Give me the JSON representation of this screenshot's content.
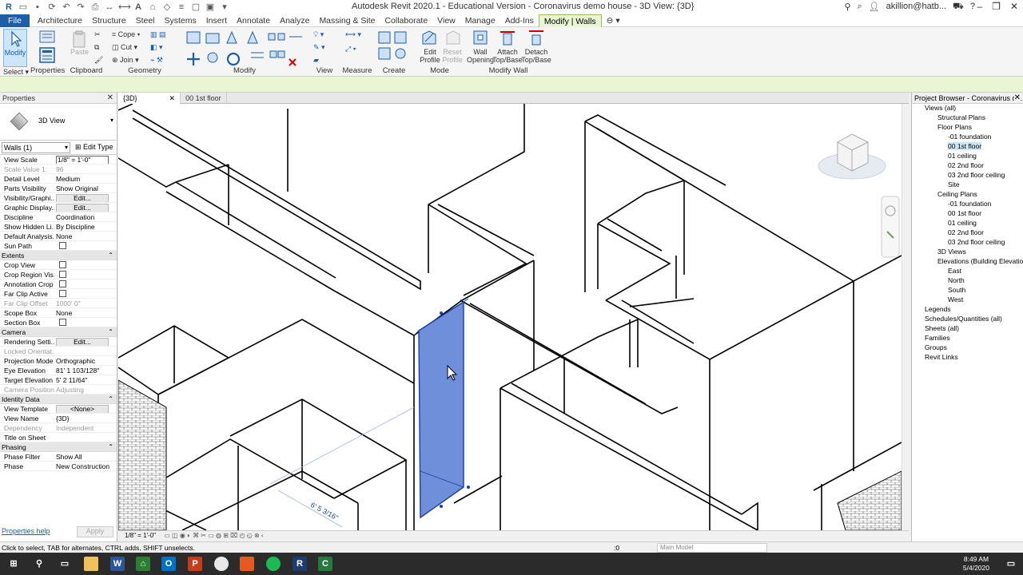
{
  "window": {
    "title": "Autodesk Revit 2020.1 - Educational Version - Coronavirus demo house - 3D View: {3D}",
    "user": "akillion@hatb..."
  },
  "menu": {
    "tabs": [
      "File",
      "Architecture",
      "Structure",
      "Steel",
      "Systems",
      "Insert",
      "Annotate",
      "Analyze",
      "Massing & Site",
      "Collaborate",
      "View",
      "Manage",
      "Add-Ins",
      "Modify | Walls"
    ]
  },
  "ribbon": {
    "modify_label": "Modify",
    "select_label": "Select",
    "properties_label": "Properties",
    "clipboard_label": "Clipboard",
    "paste_label": "Paste",
    "cope_label": "Cope",
    "cut_label": "Cut",
    "join_label": "Join",
    "geometry_label": "Geometry",
    "modify_panel_label": "Modify",
    "view_label": "View",
    "measure_label": "Measure",
    "create_label": "Create",
    "mode_label": "Mode",
    "edit_profile_1": "Edit",
    "edit_profile_2": "Profile",
    "reset_profile_1": "Reset",
    "reset_profile_2": "Profile",
    "wall_opening_1": "Wall",
    "wall_opening_2": "Opening",
    "attach_1": "Attach",
    "attach_2": "Top/Base",
    "detach_1": "Detach",
    "detach_2": "Top/Base",
    "modify_wall_label": "Modify Wall"
  },
  "properties": {
    "header": "Properties",
    "type_name": "3D View",
    "filter": "Walls (1)",
    "edit_type": "Edit Type",
    "rows": [
      {
        "k": "View Scale",
        "v": "1/8\" = 1'-0\"",
        "kind": "field"
      },
      {
        "k": "Scale Value 1:",
        "v": "96",
        "kind": "dim"
      },
      {
        "k": "Detail Level",
        "v": "Medium",
        "kind": "text"
      },
      {
        "k": "Parts Visibility",
        "v": "Show Original",
        "kind": "text"
      },
      {
        "k": "Visibility/Graphi...",
        "v": "Edit...",
        "kind": "btn"
      },
      {
        "k": "Graphic Display...",
        "v": "Edit...",
        "kind": "btn"
      },
      {
        "k": "Discipline",
        "v": "Coordination",
        "kind": "text"
      },
      {
        "k": "Show Hidden Li...",
        "v": "By Discipline",
        "kind": "text"
      },
      {
        "k": "Default Analysis...",
        "v": "None",
        "kind": "text"
      },
      {
        "k": "Sun Path",
        "v": "",
        "kind": "chk"
      },
      {
        "cat": "Extents"
      },
      {
        "k": "Crop View",
        "v": "",
        "kind": "chk"
      },
      {
        "k": "Crop Region Vis...",
        "v": "",
        "kind": "chk"
      },
      {
        "k": "Annotation Crop",
        "v": "",
        "kind": "chk"
      },
      {
        "k": "Far Clip Active",
        "v": "",
        "kind": "chk"
      },
      {
        "k": "Far Clip Offset",
        "v": "1000' 0\"",
        "kind": "dim"
      },
      {
        "k": "Scope Box",
        "v": "None",
        "kind": "text"
      },
      {
        "k": "Section Box",
        "v": "",
        "kind": "chk"
      },
      {
        "cat": "Camera"
      },
      {
        "k": "Rendering Setti...",
        "v": "Edit...",
        "kind": "btn"
      },
      {
        "k": "Locked Orientat...",
        "v": "",
        "kind": "dim"
      },
      {
        "k": "Projection Mode",
        "v": "Orthographic",
        "kind": "text"
      },
      {
        "k": "Eye Elevation",
        "v": "81' 1 103/128\"",
        "kind": "text"
      },
      {
        "k": "Target Elevation",
        "v": "5' 2 11/64\"",
        "kind": "text"
      },
      {
        "k": "Camera Position",
        "v": "Adjusting",
        "kind": "dim"
      },
      {
        "cat": "Identity Data"
      },
      {
        "k": "View Template",
        "v": "<None>",
        "kind": "btn"
      },
      {
        "k": "View Name",
        "v": "{3D}",
        "kind": "text"
      },
      {
        "k": "Dependency",
        "v": "Independent",
        "kind": "dim"
      },
      {
        "k": "Title on Sheet",
        "v": "",
        "kind": "text"
      },
      {
        "cat": "Phasing"
      },
      {
        "k": "Phase Filter",
        "v": "Show All",
        "kind": "text"
      },
      {
        "k": "Phase",
        "v": "New Construction",
        "kind": "text"
      }
    ],
    "help_link": "Properties help",
    "apply_label": "Apply"
  },
  "view_tabs": [
    {
      "label": "{3D}",
      "active": true
    },
    {
      "label": "00 1st floor",
      "active": false
    }
  ],
  "canvas": {
    "dimension_text": "6' 5 3/16\"",
    "view_scale": "1/8\" = 1'-0\""
  },
  "project_browser": {
    "header": "Project Browser - Coronavirus de...",
    "items": [
      {
        "label": "Views (all)",
        "level": 0
      },
      {
        "label": "Structural Plans",
        "level": 1
      },
      {
        "label": "Floor Plans",
        "level": 1
      },
      {
        "label": "-01 foundation",
        "level": 2
      },
      {
        "label": "00 1st floor",
        "level": 2,
        "selected": true
      },
      {
        "label": "01 ceiling",
        "level": 2
      },
      {
        "label": "02 2nd floor",
        "level": 2
      },
      {
        "label": "03 2nd floor ceiling",
        "level": 2
      },
      {
        "label": "Site",
        "level": 2
      },
      {
        "label": "Ceiling Plans",
        "level": 1
      },
      {
        "label": "-01 foundation",
        "level": 2
      },
      {
        "label": "00 1st floor",
        "level": 2
      },
      {
        "label": "01 ceiling",
        "level": 2
      },
      {
        "label": "02 2nd floor",
        "level": 2
      },
      {
        "label": "03 2nd floor ceiling",
        "level": 2
      },
      {
        "label": "3D Views",
        "level": 1
      },
      {
        "label": "Elevations (Building Elevation)",
        "level": 1
      },
      {
        "label": "East",
        "level": 2
      },
      {
        "label": "North",
        "level": 2
      },
      {
        "label": "South",
        "level": 2
      },
      {
        "label": "West",
        "level": 2
      },
      {
        "label": "Legends",
        "level": 0
      },
      {
        "label": "Schedules/Quantities (all)",
        "level": 0
      },
      {
        "label": "Sheets (all)",
        "level": 0
      },
      {
        "label": "Families",
        "level": 0
      },
      {
        "label": "Groups",
        "level": 0
      },
      {
        "label": "Revit Links",
        "level": 0
      }
    ]
  },
  "status": {
    "text": "Click to select, TAB for alternates, CTRL adds, SHIFT unselects.",
    "zero": ":0",
    "model": "Main Model"
  },
  "taskbar": {
    "time": "8:49 AM",
    "date": "5/4/2020"
  },
  "colors": {
    "accent": "#1b5faa",
    "selection": "#6f8fdb",
    "contextual_tab": "#e9f5d3"
  }
}
